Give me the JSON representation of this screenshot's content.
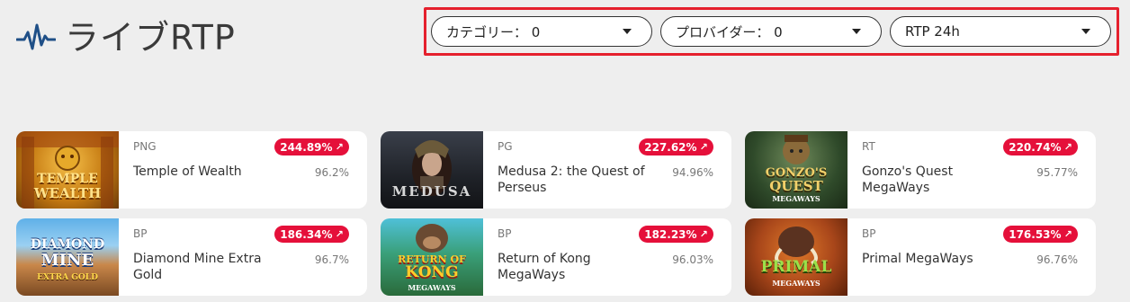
{
  "header": {
    "title": "ライブRTP"
  },
  "filters": [
    {
      "label": "カテゴリー： 0"
    },
    {
      "label": "プロバイダー： 0"
    },
    {
      "label": "RTP 24h"
    }
  ],
  "games": [
    {
      "provider": "PNG",
      "badge": "244.89%",
      "name": "Temple of Wealth",
      "rtp": "96.2%",
      "thumb_lines": [
        "TEMPLE",
        "WEALTH"
      ]
    },
    {
      "provider": "PG",
      "badge": "227.62%",
      "name": "Medusa 2: the Quest of Perseus",
      "rtp": "94.96%",
      "thumb_lines": [
        "MEDUSA"
      ]
    },
    {
      "provider": "RT",
      "badge": "220.74%",
      "name": "Gonzo's Quest MegaWays",
      "rtp": "95.77%",
      "thumb_lines": [
        "GONZO'S",
        "QUEST",
        "MEGAWAYS"
      ]
    },
    {
      "provider": "BP",
      "badge": "186.34%",
      "name": "Diamond Mine Extra Gold",
      "rtp": "96.7%",
      "thumb_lines": [
        "DIAMOND",
        "MINE",
        "EXTRA GOLD"
      ]
    },
    {
      "provider": "BP",
      "badge": "182.23%",
      "name": "Return of Kong MegaWays",
      "rtp": "96.03%",
      "thumb_lines": [
        "RETURN OF",
        "KONG",
        "MEGAWAYS"
      ]
    },
    {
      "provider": "BP",
      "badge": "176.53%",
      "name": "Primal MegaWays",
      "rtp": "96.76%",
      "thumb_lines": [
        "PRIMAL",
        "MEGAWAYS"
      ]
    }
  ]
}
